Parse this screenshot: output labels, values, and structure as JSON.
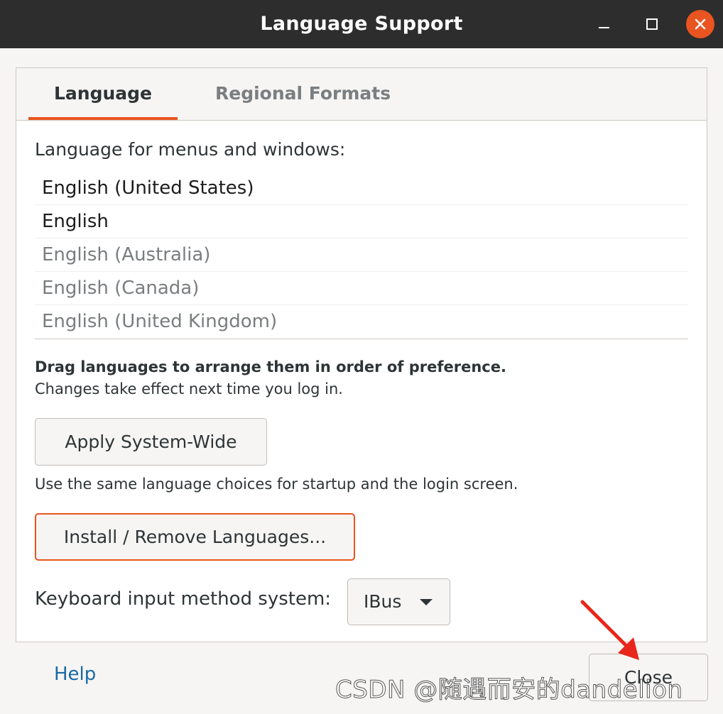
{
  "window": {
    "title": "Language Support",
    "controls": [
      "minimize-icon",
      "maximize-icon",
      "close-icon"
    ],
    "accent_color": "#e95420"
  },
  "tabs": [
    {
      "label": "Language",
      "active": true
    },
    {
      "label": "Regional Formats",
      "active": false
    }
  ],
  "language": {
    "menus_label": "Language for menus and windows:",
    "items": [
      {
        "label": "English (United States)",
        "active": true
      },
      {
        "label": "English",
        "active": true
      },
      {
        "label": "English (Australia)",
        "active": false
      },
      {
        "label": "English (Canada)",
        "active": false
      },
      {
        "label": "English (United Kingdom)",
        "active": false
      }
    ],
    "drag_note_bold": "Drag languages to arrange them in order of preference.",
    "drag_note": "Changes take effect next time you log in.",
    "apply_button": "Apply System-Wide",
    "apply_note": "Use the same language choices for startup and the login screen.",
    "install_button": "Install / Remove Languages...",
    "keyboard_label": "Keyboard input method system:",
    "keyboard_value": "IBus"
  },
  "footer": {
    "help": "Help",
    "close": "Close"
  },
  "watermark": "CSDN @随遇而安的dandelion"
}
